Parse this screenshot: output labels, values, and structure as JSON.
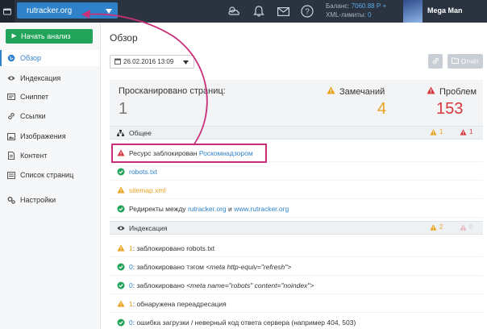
{
  "topbar": {
    "site": "rutracker.org",
    "balance_label": "Баланс:",
    "balance_value": "7060.88",
    "balance_currency": "Р",
    "xml_label": "XML-лимиты:",
    "xml_value": "0",
    "username": "Mega Man"
  },
  "sidebar": {
    "start_button": "Начать анализ",
    "items": [
      {
        "label": "Обзор",
        "icon": "globe-icon"
      },
      {
        "label": "Индексация",
        "icon": "eye-icon"
      },
      {
        "label": "Сниппет",
        "icon": "card-icon"
      },
      {
        "label": "Ссылки",
        "icon": "link-icon"
      },
      {
        "label": "Изображения",
        "icon": "image-icon"
      },
      {
        "label": "Контент",
        "icon": "document-icon"
      },
      {
        "label": "Список страниц",
        "icon": "list-icon"
      },
      {
        "label": "Настройки",
        "icon": "gears-icon"
      }
    ]
  },
  "main": {
    "title": "Обзор",
    "date": "26.02.2016 13:09",
    "report_button": "Отчёт",
    "stats": {
      "scanned_label": "Просканировано страниц:",
      "scanned_value": "1",
      "warnings_label": "Замечаний",
      "warnings_value": "4",
      "problems_label": "Проблем",
      "problems_value": "153"
    },
    "general": {
      "title": "Общее",
      "warn_count": "1",
      "err_count": "1",
      "rows": {
        "blocked_text": "Ресурс заблокирован",
        "blocked_link": "Роскомнадзором",
        "robots": "robots.txt",
        "sitemap": "sitemap.xml",
        "redirect_text": "Редиректы между",
        "redirect_link1": "rutracker.org",
        "redirect_and": "и",
        "redirect_link2": "www.rutracker.org"
      }
    },
    "indexing": {
      "title": "Индексация",
      "warn_count": "2",
      "err_count": "0",
      "rows": [
        {
          "num": "1",
          "text": ": заблокировано robots.txt",
          "status": "warning"
        },
        {
          "num": "0",
          "text": ": заблокировано тэгом ",
          "code": "<meta http-equiv=\"refresh\">",
          "status": "ok"
        },
        {
          "num": "0",
          "text": ": заблокировано ",
          "code": "<meta name=\"robots\" content=\"noindex\">",
          "status": "ok"
        },
        {
          "num": "1",
          "text": ": обнаружена переадресация",
          "status": "warning"
        },
        {
          "num": "0",
          "text": ": ошибка загрузки / неверный код ответа сервера (например 404, 503)",
          "status": "ok"
        }
      ]
    }
  },
  "colors": {
    "topbar": "#2b3340",
    "accent": "#2f82c9",
    "ok": "#22a35a",
    "warning": "#e8a21b",
    "error": "#d9363e",
    "highlight": "#c8307a"
  }
}
